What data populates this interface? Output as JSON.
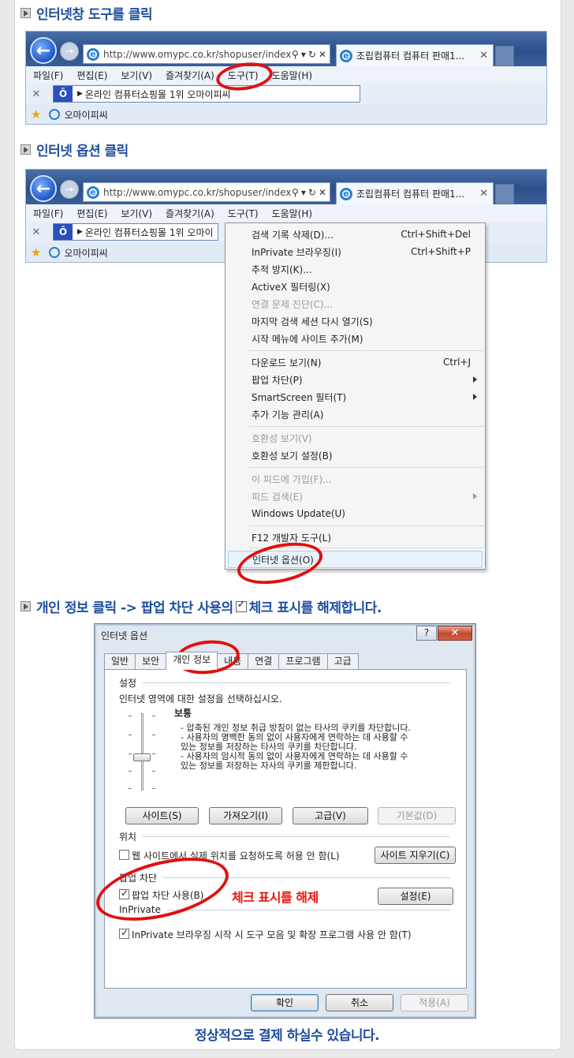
{
  "steps": [
    {
      "title": "인터넷창 도구를 클릭"
    },
    {
      "title": "인터넷 옵션 클릭"
    },
    {
      "title_before": "개인 정보 클릭 -> 팝업 차단 사용의",
      "title_after": "체크 표시를 해제합니다."
    }
  ],
  "browser": {
    "url": "http://www.omypc.co.kr/shopuser/index.",
    "tab_title": "조립컴퓨터 컴퓨터 판매1...",
    "menu": [
      "파일(F)",
      "편집(E)",
      "보기(V)",
      "즐겨찾기(A)",
      "도구(T)",
      "도움말(H)"
    ],
    "cmd_text": "온라인 컴퓨터쇼핑몰 1위 오마이피씨",
    "cmd_text_short": "온라인 컴퓨터쇼핑몰 1위 오마이",
    "favorite": "오마이피씨"
  },
  "tools_menu": {
    "items": [
      {
        "label": "검색 기록 삭제(D)...",
        "shortcut": "Ctrl+Shift+Del",
        "disabled": false
      },
      {
        "label": "InPrivate 브라우징(I)",
        "shortcut": "Ctrl+Shift+P",
        "disabled": false
      },
      {
        "label": "추적 방지(K)...",
        "shortcut": "",
        "disabled": false
      },
      {
        "label": "ActiveX 필터링(X)",
        "shortcut": "",
        "disabled": false
      },
      {
        "label": "연결 문제 진단(C)...",
        "shortcut": "",
        "disabled": true
      },
      {
        "label": "마지막 검색 세션 다시 열기(S)",
        "shortcut": "",
        "disabled": false
      },
      {
        "label": "시작 메뉴에 사이트 추가(M)",
        "shortcut": "",
        "disabled": false
      },
      {
        "label": "다운로드 보기(N)",
        "shortcut": "Ctrl+J",
        "disabled": false
      },
      {
        "label": "팝업 차단(P)",
        "shortcut": "",
        "submenu": true,
        "disabled": false
      },
      {
        "label": "SmartScreen 필터(T)",
        "shortcut": "",
        "submenu": true,
        "disabled": false
      },
      {
        "label": "추가 기능 관리(A)",
        "shortcut": "",
        "disabled": false
      },
      {
        "label": "호환성 보기(V)",
        "shortcut": "",
        "disabled": true
      },
      {
        "label": "호환성 보기 설정(B)",
        "shortcut": "",
        "disabled": false
      },
      {
        "label": "이 피드에 가입(F)...",
        "shortcut": "",
        "disabled": true
      },
      {
        "label": "피드 검색(E)",
        "shortcut": "",
        "submenu": true,
        "disabled": true
      },
      {
        "label": "Windows Update(U)",
        "shortcut": "",
        "disabled": false
      },
      {
        "label": "F12 개발자 도구(L)",
        "shortcut": "",
        "disabled": false
      },
      {
        "label": "인터넷 옵션(O)",
        "shortcut": "",
        "disabled": false,
        "highlighted": true
      }
    ]
  },
  "dialog": {
    "title": "인터넷 옵션",
    "help_label": "?",
    "close_label": "✕",
    "tabs": [
      "일반",
      "보안",
      "개인 정보",
      "내용",
      "연결",
      "프로그램",
      "고급"
    ],
    "settings_group": "설정",
    "settings_desc": "인터넷 영역에 대한 설정을 선택하십시오.",
    "level": "보통",
    "level_desc": [
      "- 압축된 개인 정보 취급 방침이 없는 타사의 쿠키를 차단합니다.",
      "- 사용자의 명백한 동의 없이 사용자에게 연락하는 데 사용할 수",
      "있는 정보를 저장하는 타사의 쿠키를 차단합니다.",
      "- 사용자의 암시적 동의 없이 사용자에게 연락하는 데 사용할 수",
      "있는 정보를 저장하는 자사의 쿠키를 제한합니다."
    ],
    "buttons": {
      "sites": "사이트(S)",
      "import": "가져오기(I)",
      "advanced": "고급(V)",
      "default": "기본값(D)"
    },
    "location_group": "위치",
    "location_check": "웹 사이트에서 실제 위치를 요청하도록 허용 안 함(L)",
    "clear_sites": "사이트 지우기(C)",
    "popup_group": "팝업 차단",
    "popup_check": "팝업 차단 사용(B)",
    "popup_settings": "설정(E)",
    "inprivate_group": "InPrivate",
    "inprivate_check": "InPrivate 브라우징 시작 시 도구 모음 및 확장 프로그램 사용 안 함(T)",
    "ok": "확인",
    "cancel": "취소",
    "apply": "적용(A)"
  },
  "annotation": "체크 표시를 해제",
  "footer_note": "정상적으로 결제 하실수 있습니다.",
  "colors": {
    "title_blue": "#1f4ea0",
    "annotation_red": "#e8140c"
  }
}
